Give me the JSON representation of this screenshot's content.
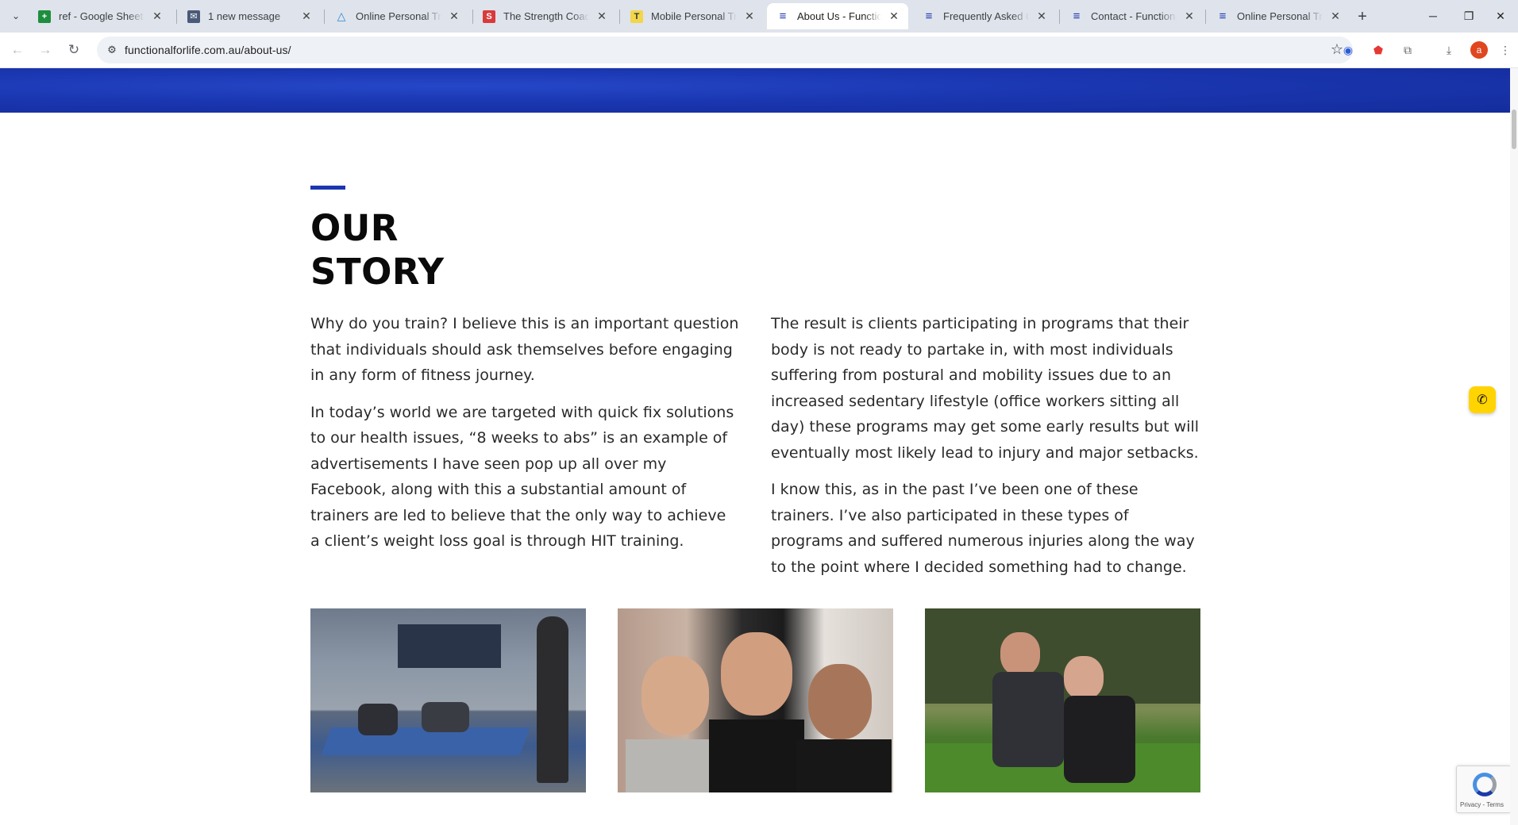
{
  "browser": {
    "tabs": [
      {
        "title": "ref - Google Sheets",
        "favicon": "sheets-icon",
        "active": false
      },
      {
        "title": "1 new message",
        "favicon": "mail-icon",
        "active": false
      },
      {
        "title": "Online Personal Train",
        "favicon": "triangle-logo-icon",
        "active": false
      },
      {
        "title": "The Strength Coach |",
        "favicon": "strength-coach-icon",
        "active": false
      },
      {
        "title": "Mobile Personal Train",
        "favicon": "mobile-trainer-icon",
        "active": false
      },
      {
        "title": "About Us - Functiona",
        "favicon": "functional-life-icon",
        "active": true
      },
      {
        "title": "Frequently Asked Qu",
        "favicon": "functional-life-icon",
        "active": false
      },
      {
        "title": "Contact - Functional",
        "favicon": "functional-life-icon",
        "active": false
      },
      {
        "title": "Online Personal Train",
        "favicon": "functional-life-icon",
        "active": false
      }
    ],
    "url": "functionalforlife.com.au/about-us/",
    "profile_initial": "a"
  },
  "page": {
    "heading_line1": "OUR",
    "heading_line2": "STORY",
    "left_paragraphs": [
      "Why do you train? I believe this is an important question that individuals should ask themselves before engaging in any form of fitness journey.",
      "In today’s world we are targeted with quick fix solutions to our health issues, “8 weeks to abs” is an example of advertisements I have seen pop up all over my Facebook, along with this a substantial amount of trainers are led to believe that the only way to achieve a client’s weight loss goal is through HIT training."
    ],
    "right_paragraphs": [
      "The result is clients participating in programs that their body is not ready to partake in, with most individuals suffering from postural and mobility issues due to an increased sedentary lifestyle (office workers sitting all day) these programs may get some early results but will eventually most likely lead to injury and major setbacks.",
      "I know this, as in the past I’ve been one of these trainers. I’ve also participated in these types of programs and suffered numerous injuries along the way to the point where I decided something had to change."
    ],
    "recaptcha_terms": "Privacy - Terms"
  },
  "colors": {
    "brand_blue": "#1a36b0",
    "call_button": "#ffd400"
  }
}
